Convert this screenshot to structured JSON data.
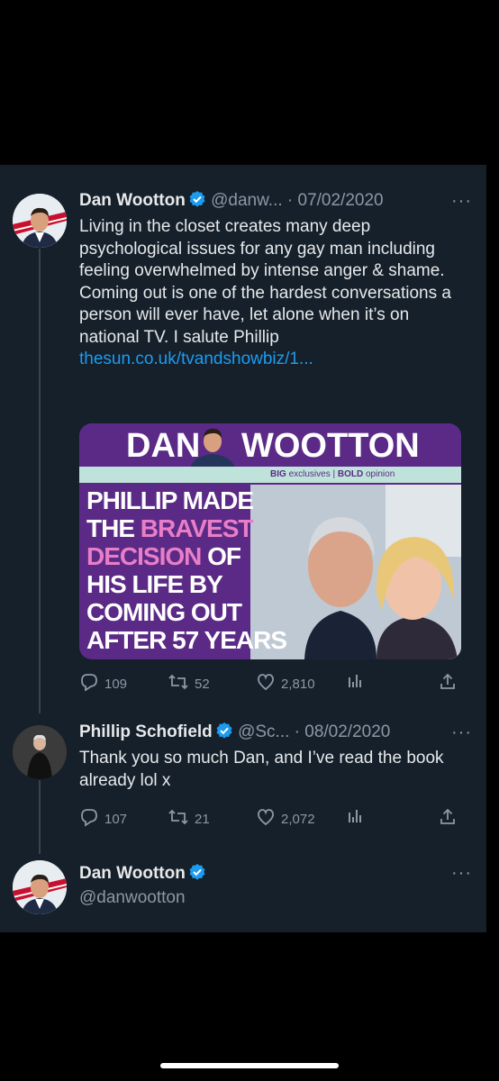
{
  "tweet1": {
    "name": "Dan Wootton",
    "handle": "@danw...",
    "date": "· 07/02/2020",
    "text_plain": "Living in the closet creates many deep psychological issues for any gay man including feeling overwhelmed by intense anger & shame. Coming out is one of the hardest conversations a person will ever have, let alone when it’s on national TV. I salute Phillip ",
    "link": "thesun.co.uk/tvandshowbiz/1...",
    "media": {
      "header_left": "DAN",
      "header_right": "WOOTTON",
      "tag_big": "BIG",
      "tag_exclusives": "exclusives",
      "tag_sep": "|",
      "tag_bold": "BOLD",
      "tag_opinion": "opinion",
      "headline": [
        {
          "white": "PHILLIP MADE",
          "pink": ""
        },
        {
          "white": "THE ",
          "pink": "BRAVEST"
        },
        {
          "white": "",
          "pink": "DECISION",
          "tail": " OF"
        },
        {
          "white": "HIS LIFE BY",
          "pink": ""
        },
        {
          "white": "COMING OUT",
          "pink": ""
        },
        {
          "white": "AFTER 57 YEARS",
          "pink": ""
        }
      ]
    },
    "replies": "109",
    "retweets": "52",
    "likes": "2,810"
  },
  "tweet2": {
    "name": "Phillip Schofield",
    "handle": "@Sc...",
    "date": "· 08/02/2020",
    "text": "Thank you so much Dan, and I’ve read the book already lol x",
    "replies": "107",
    "retweets": "21",
    "likes": "2,072"
  },
  "tweet3": {
    "name": "Dan Wootton",
    "handle": "@danwootton"
  },
  "icons": [
    "verified-badge-icon",
    "more-icon",
    "reply-icon",
    "retweet-icon",
    "like-icon",
    "views-icon",
    "share-icon"
  ],
  "colors": {
    "background": "#15202b",
    "link": "#1d9bf0",
    "muted": "#8b98a5",
    "verified": "#1d9bf0",
    "media_purple": "#5b2a86",
    "media_pink": "#e97ec7"
  }
}
